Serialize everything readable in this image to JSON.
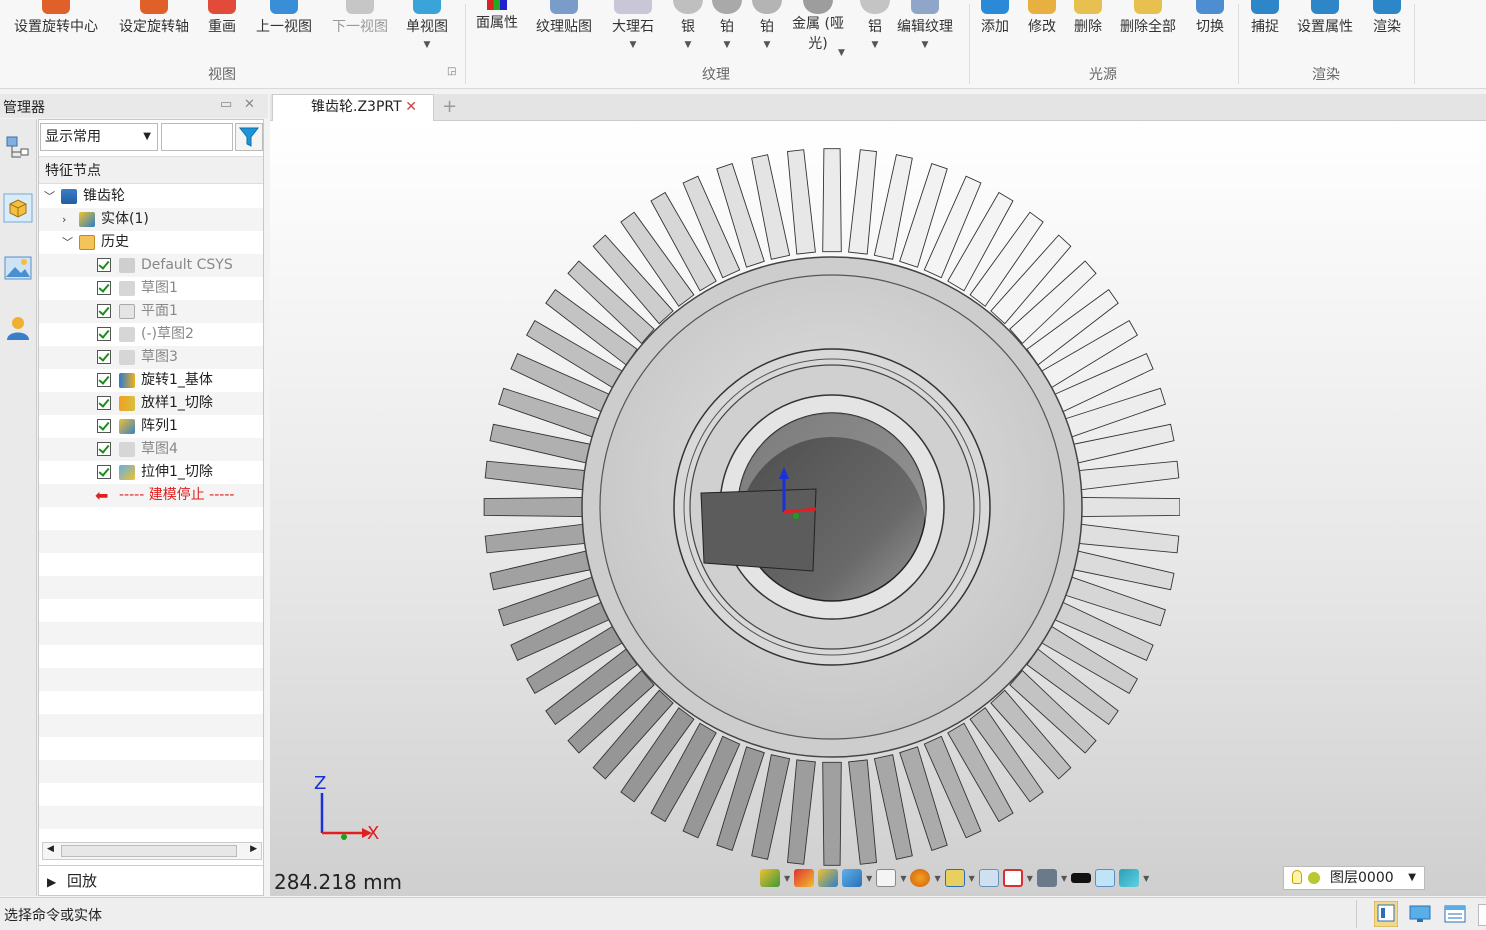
{
  "ribbon": {
    "view_group": {
      "label": "视图",
      "items": [
        {
          "label": "设置旋转中心",
          "icon": "rotate-center-icon"
        },
        {
          "label": "设定旋转轴",
          "icon": "rotate-axis-icon"
        },
        {
          "label": "重画",
          "icon": "redraw-icon"
        },
        {
          "label": "上一视图",
          "icon": "previous-view-icon"
        },
        {
          "label": "下一视图",
          "icon": "next-view-icon",
          "disabled": true
        },
        {
          "label": "单视图",
          "icon": "single-view-icon"
        }
      ]
    },
    "texture_group": {
      "label": "纹理",
      "items": [
        {
          "label": "面属性",
          "icon": "face-properties-icon"
        },
        {
          "label": "纹理贴图",
          "icon": "texture-map-icon"
        },
        {
          "label": "大理石",
          "icon": "marble-icon"
        },
        {
          "label": "银",
          "icon": "silver-icon"
        },
        {
          "label": "铂",
          "icon": "platinum-icon"
        },
        {
          "label": "铂",
          "icon": "platinum-icon"
        },
        {
          "label": "金属 (哑光)",
          "icon": "matte-metal-icon"
        },
        {
          "label": "铝",
          "icon": "aluminum-icon"
        },
        {
          "label": "编辑纹理",
          "icon": "edit-texture-icon"
        }
      ]
    },
    "light_group": {
      "label": "光源",
      "items": [
        {
          "label": "添加",
          "icon": "add-light-icon"
        },
        {
          "label": "修改",
          "icon": "modify-light-icon"
        },
        {
          "label": "删除",
          "icon": "delete-light-icon"
        },
        {
          "label": "删除全部",
          "icon": "delete-all-lights-icon"
        },
        {
          "label": "切换",
          "icon": "toggle-light-icon"
        }
      ]
    },
    "render_group": {
      "label": "渲染",
      "items": [
        {
          "label": "捕捉",
          "icon": "capture-icon"
        },
        {
          "label": "设置属性",
          "icon": "set-properties-icon"
        },
        {
          "label": "渲染",
          "icon": "render-icon"
        }
      ]
    }
  },
  "manager": {
    "title": "管理器",
    "filter_value": "显示常用",
    "tree_header": "特征节点",
    "tree": [
      {
        "label": "锥齿轮",
        "icon": "part-icon",
        "level": 0,
        "expanded": true
      },
      {
        "label": "实体(1)",
        "icon": "solid-icon",
        "level": 1,
        "expanded": false
      },
      {
        "label": "历史",
        "icon": "folder-icon",
        "level": 1,
        "expanded": true
      },
      {
        "label": "Default CSYS",
        "icon": "csys-icon",
        "level": 2,
        "checked": true,
        "dim": true
      },
      {
        "label": "草图1",
        "icon": "sketch-icon",
        "level": 2,
        "checked": true,
        "dim": true
      },
      {
        "label": "平面1",
        "icon": "plane-icon",
        "level": 2,
        "checked": true,
        "dim": true
      },
      {
        "label": "(-)草图2",
        "icon": "sketch-icon",
        "level": 2,
        "checked": true,
        "dim": true
      },
      {
        "label": "草图3",
        "icon": "sketch-icon",
        "level": 2,
        "checked": true,
        "dim": true
      },
      {
        "label": "旋转1_基体",
        "icon": "revolve-icon",
        "level": 2,
        "checked": true,
        "dim": false
      },
      {
        "label": "放样1_切除",
        "icon": "loft-cut-icon",
        "level": 2,
        "checked": true,
        "dim": false
      },
      {
        "label": "阵列1",
        "icon": "pattern-icon",
        "level": 2,
        "checked": true,
        "dim": false
      },
      {
        "label": "草图4",
        "icon": "sketch-icon",
        "level": 2,
        "checked": true,
        "dim": true
      },
      {
        "label": "拉伸1_切除",
        "icon": "extrude-cut-icon",
        "level": 2,
        "checked": true,
        "dim": false
      }
    ],
    "stop_label": "----- 建模停止 -----",
    "replay_label": "回放"
  },
  "document": {
    "tab_label": "锥齿轮.Z3PRT",
    "measurement": "284.218 mm",
    "triad": {
      "z": "Z",
      "x": "X"
    },
    "layer": "图层0000"
  },
  "status": {
    "text": "选择命令或实体"
  },
  "colors": {
    "accent": "#1c7fd6",
    "stop": "#e02020",
    "check": "#1a8c1a"
  }
}
